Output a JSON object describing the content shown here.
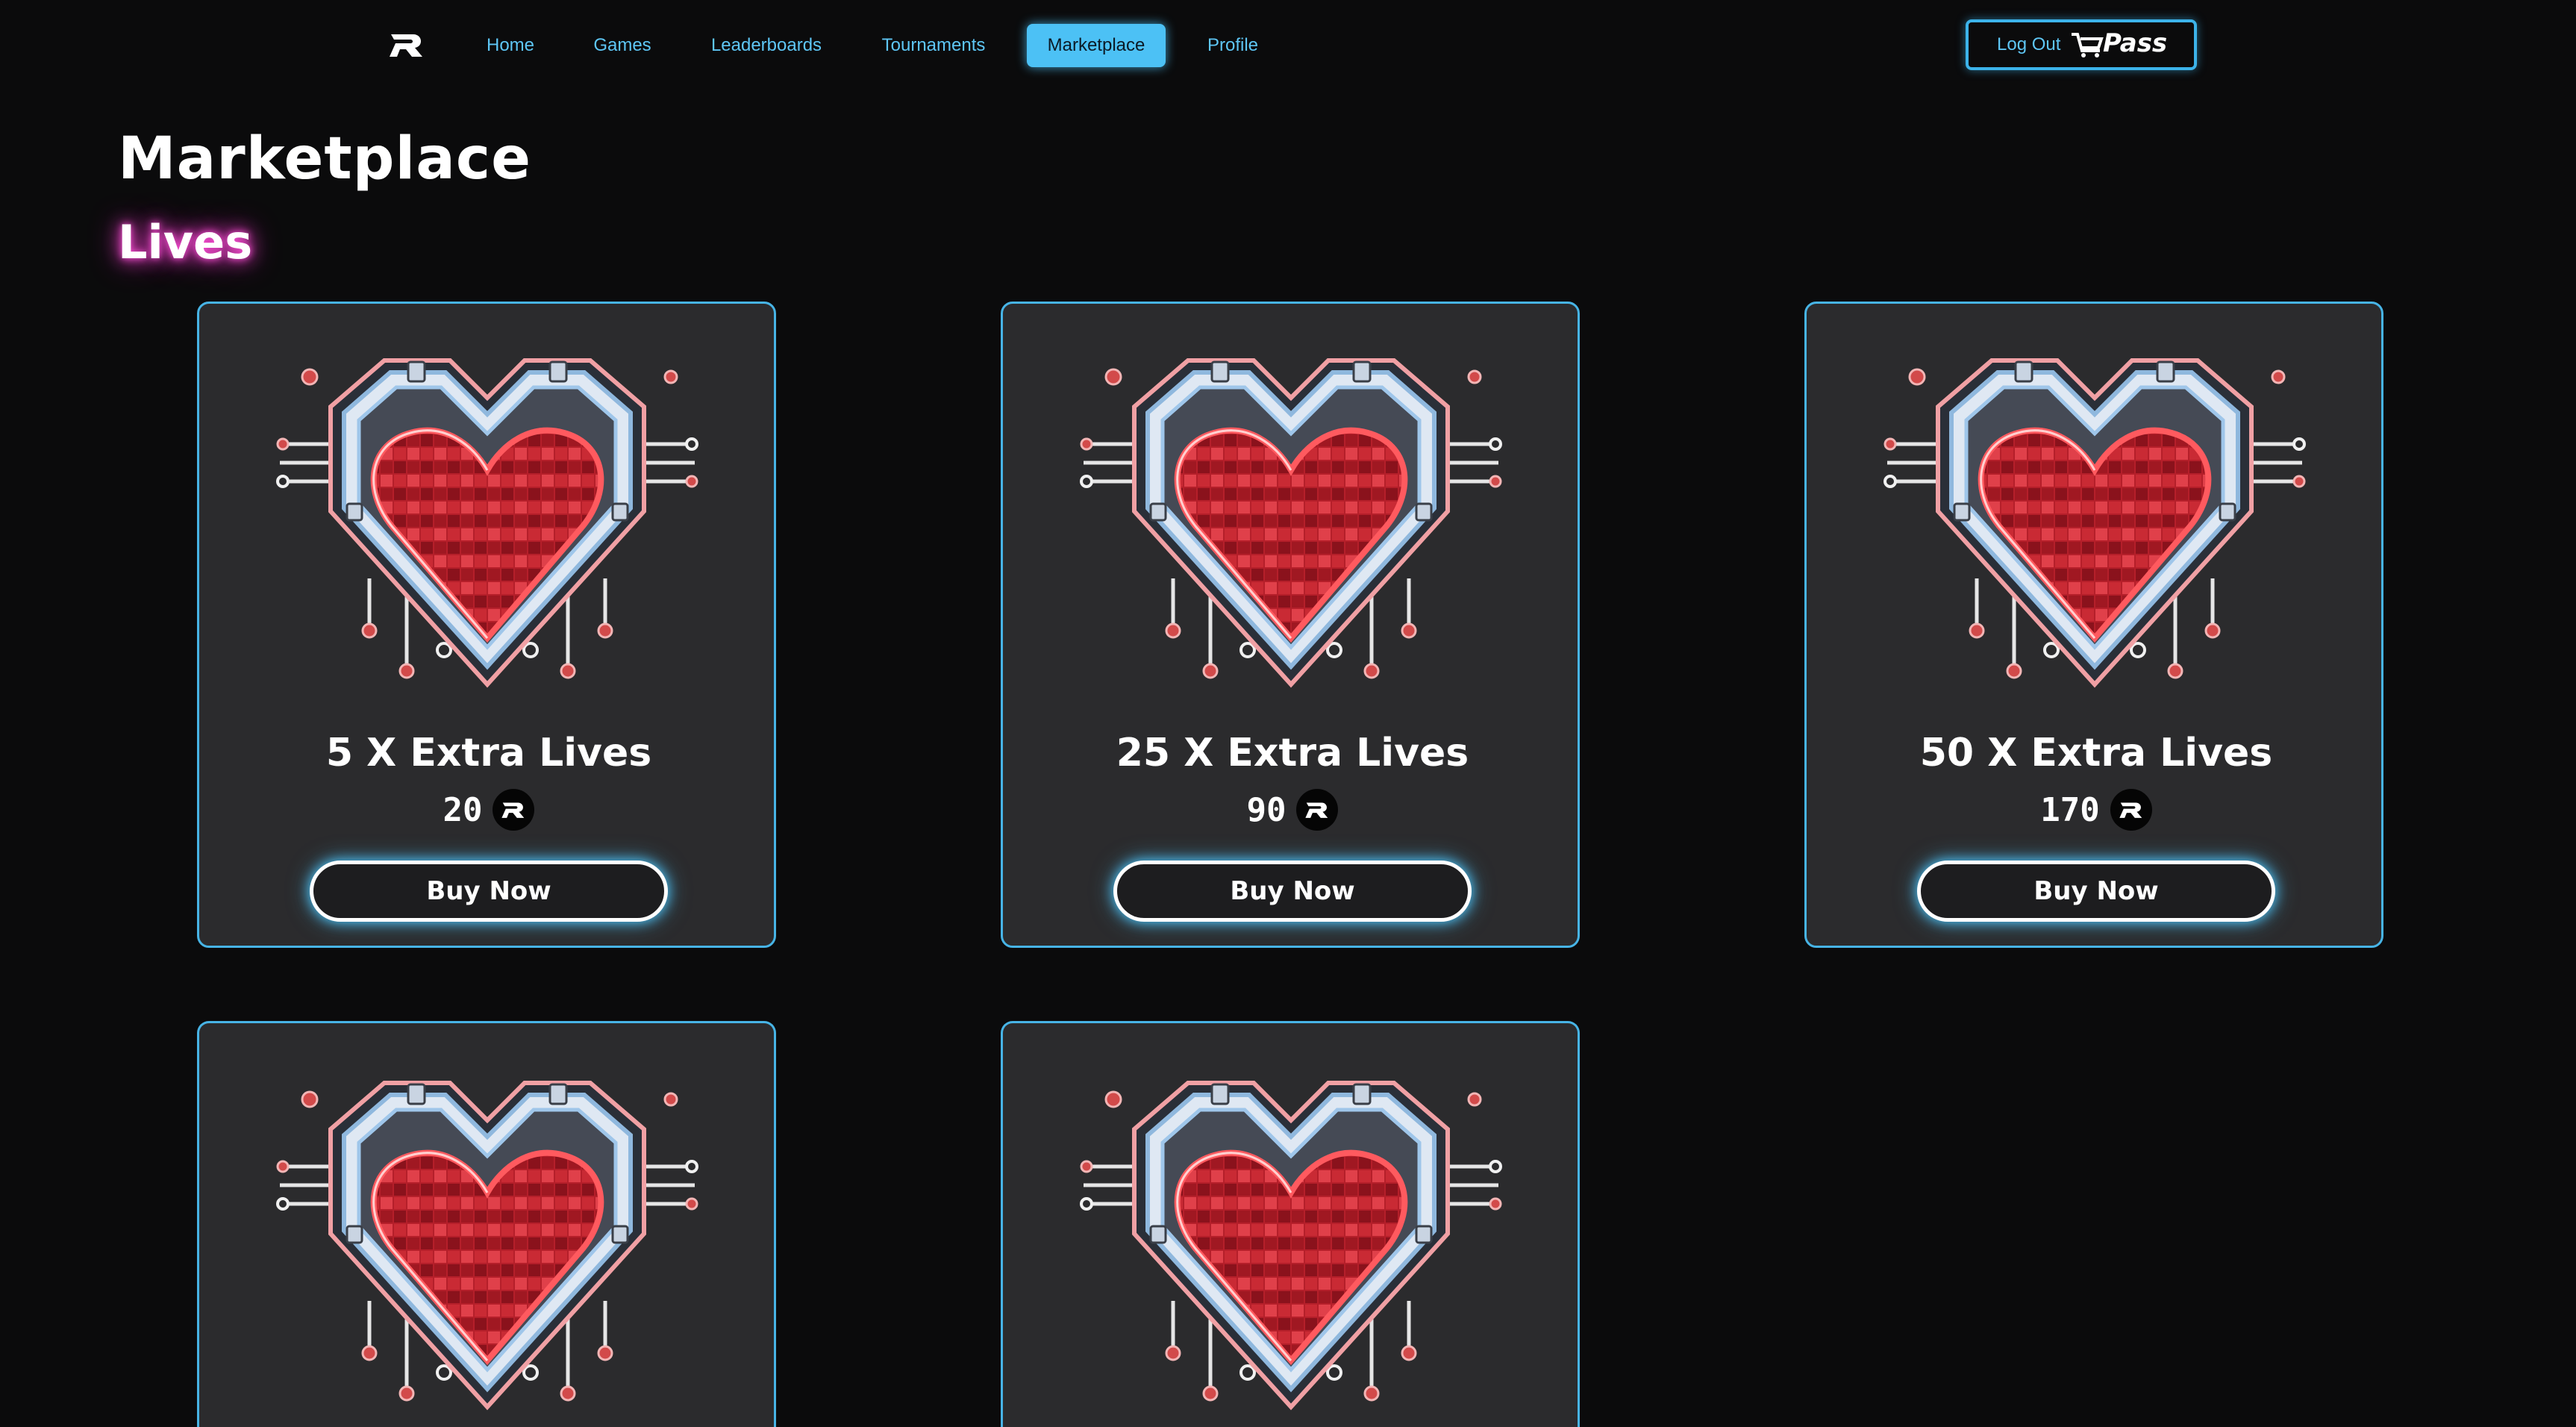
{
  "nav": {
    "links": [
      "Home",
      "Games",
      "Leaderboards",
      "Tournaments",
      "Marketplace",
      "Profile"
    ],
    "active": "Marketplace",
    "logout_label": "Log Out",
    "pass_label": "Pass"
  },
  "page": {
    "title": "Marketplace",
    "section_title": "Lives"
  },
  "products": [
    {
      "title": "5 X Extra Lives",
      "price": "20",
      "button": "Buy Now",
      "image": "pixel-heart-icon"
    },
    {
      "title": "25 X Extra Lives",
      "price": "90",
      "button": "Buy Now",
      "image": "pixel-heart-icon"
    },
    {
      "title": "50 X Extra Lives",
      "price": "170",
      "button": "Buy Now",
      "image": "pixel-heart-icon"
    },
    {
      "image": "pixel-heart-icon"
    },
    {
      "image": "pixel-heart-icon"
    }
  ],
  "colors": {
    "background": "#0b0b0c",
    "accent": "#4cc1f5",
    "card": "#2b2b2d",
    "section_glow": "#ff4fd8",
    "heart_red": "#d8202a"
  }
}
